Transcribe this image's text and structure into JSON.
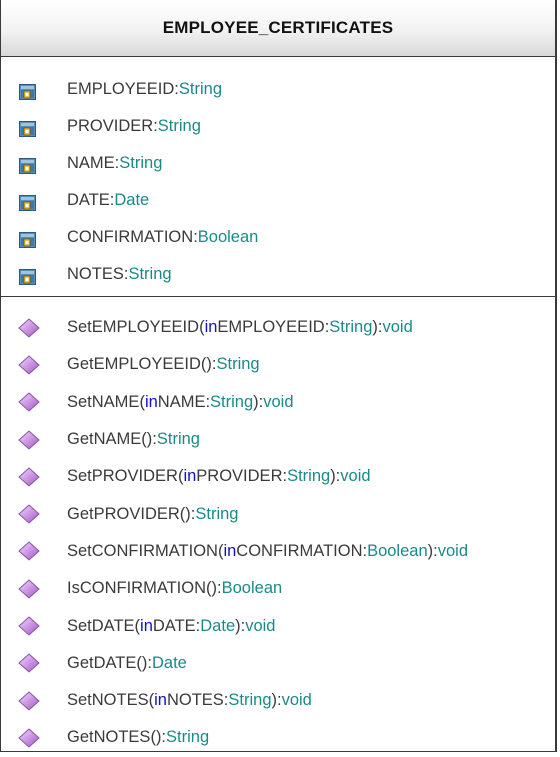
{
  "class_name": "EMPLOYEE_CERTIFICATES",
  "attributes": [
    {
      "name": "EMPLOYEEID",
      "type": "String"
    },
    {
      "name": "PROVIDER",
      "type": "String"
    },
    {
      "name": "NAME",
      "type": "String"
    },
    {
      "name": "DATE",
      "type": "Date"
    },
    {
      "name": "CONFIRMATION",
      "type": "Boolean"
    },
    {
      "name": "NOTES",
      "type": "String"
    }
  ],
  "operations": [
    {
      "name": "SetEMPLOYEEID",
      "dir": "in",
      "param": "EMPLOYEEID",
      "ptype": "String",
      "ret": "void"
    },
    {
      "name": "GetEMPLOYEEID",
      "ret": "String"
    },
    {
      "name": "SetNAME",
      "dir": "in",
      "param": "NAME",
      "ptype": "String",
      "ret": "void"
    },
    {
      "name": "GetNAME",
      "ret": "String"
    },
    {
      "name": "SetPROVIDER",
      "dir": "in",
      "param": "PROVIDER",
      "ptype": "String",
      "ret": "void"
    },
    {
      "name": "GetPROVIDER",
      "ret": "String"
    },
    {
      "name": "SetCONFIRMATION",
      "dir": "in",
      "param": "CONFIRMATION",
      "ptype": "Boolean",
      "ret": "void"
    },
    {
      "name": "IsCONFIRMATION",
      "ret": "Boolean"
    },
    {
      "name": "SetDATE",
      "dir": "in",
      "param": "DATE",
      "ptype": "Date",
      "ret": "void"
    },
    {
      "name": "GetDATE",
      "ret": "Date"
    },
    {
      "name": "SetNOTES",
      "dir": "in",
      "param": "NOTES",
      "ptype": "String",
      "ret": "void"
    },
    {
      "name": "GetNOTES",
      "ret": "String"
    }
  ],
  "icons": {
    "attribute": "private-attribute-icon",
    "operation": "operation-diamond-icon"
  },
  "colors": {
    "type": "#1a8a88",
    "keyword": "#1010cc",
    "text": "#3a3a3a",
    "operation_icon": "#c98fe0"
  }
}
